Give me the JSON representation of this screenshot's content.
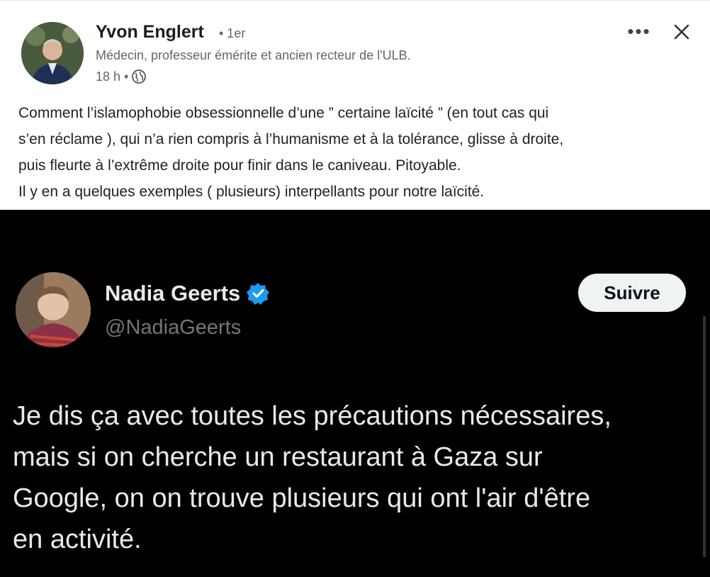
{
  "post": {
    "author_name": "Yvon Englert",
    "connection_degree": "• 1er",
    "headline": "Médecin, professeur émérite et ancien recteur de l'ULB.",
    "time": "18 h •",
    "visibility_icon": "globe-icon",
    "more_label": "•••",
    "close_icon": "close-icon",
    "text_lines": [
      "Comment l’islamophobie obsessionnelle d’une ” certaine laïcité ” (en tout cas qui",
      "s’en réclame ), qui n’a rien compris à l’humanisme et à la tolérance, glisse à droite,",
      "puis fleurte à l’extrême droite pour finir dans le caniveau. Pitoyable.",
      "Il y en a quelques exemples ( plusieurs) interpellants pour notre laïcité."
    ]
  },
  "tweet": {
    "name": "Nadia Geerts",
    "handle": "@NadiaGeerts",
    "verified_icon": "verified-badge-icon",
    "follow_label": "Suivre",
    "text_lines": [
      "Je dis ça avec toutes les précautions nécessaires,",
      "mais si on cherche un restaurant à Gaza sur",
      "Google, on on trouve plusieurs qui ont l'air d'être",
      "en activité."
    ]
  },
  "colors": {
    "tweet_background": "#000000",
    "verified_blue": "#1d9bf0",
    "follow_button_bg": "#eff3f4"
  }
}
